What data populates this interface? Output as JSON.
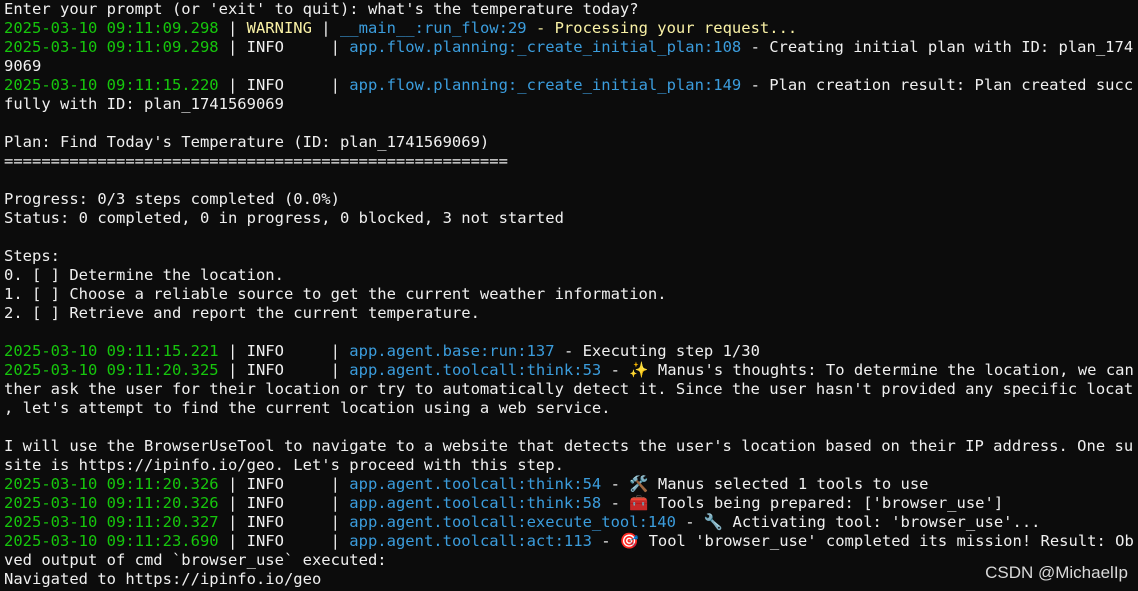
{
  "prompt": "Enter your prompt (or 'exit' to quit): what's the temperature today?",
  "log": [
    {
      "ts": "2025-03-10 09:11:09.298",
      "level": "WARNING",
      "sep": " | ",
      "module": "__main__:run_flow:29",
      "msg": " - Processing your request..."
    },
    {
      "ts": "2025-03-10 09:11:09.298",
      "level": "INFO    ",
      "sep": " | ",
      "module": "app.flow.planning:_create_initial_plan:108",
      "msg": " - Creating initial plan with ID: plan_174156",
      "cont": "9069"
    },
    {
      "ts": "2025-03-10 09:11:15.220",
      "level": "INFO    ",
      "sep": " | ",
      "module": "app.flow.planning:_create_initial_plan:149",
      "msg": " - Plan creation result: Plan created success",
      "cont": "fully with ID: plan_1741569069"
    }
  ],
  "plan": {
    "title": "Plan: Find Today's Temperature (ID: plan_1741569069)",
    "rule": "======================================================",
    "progress": "Progress: 0/3 steps completed (0.0%)",
    "status": "Status: 0 completed, 0 in progress, 0 blocked, 3 not started",
    "steps_header": "Steps:",
    "steps": [
      "0. [ ] Determine the location.",
      "1. [ ] Choose a reliable source to get the current weather information.",
      "2. [ ] Retrieve and report the current temperature."
    ]
  },
  "log2": [
    {
      "ts": "2025-03-10 09:11:15.221",
      "level": "INFO    ",
      "sep": " | ",
      "module": "app.agent.base:run:137",
      "msg": " - Executing step 1/30"
    },
    {
      "ts": "2025-03-10 09:11:20.325",
      "level": "INFO    ",
      "sep": " | ",
      "module": "app.agent.toolcall:think:53",
      "msg": " - ✨ Manus's thoughts: To determine the location, we can ei",
      "cont": "ther ask the user for their location or try to automatically detect it. Since the user hasn't provided any specific location",
      "cont2": ", let's attempt to find the current location using a web service."
    }
  ],
  "thought_para": [
    "I will use the BrowserUseTool to navigate to a website that detects the user's location based on their IP address. One such",
    "site is https://ipinfo.io/geo. Let's proceed with this step."
  ],
  "log3": [
    {
      "ts": "2025-03-10 09:11:20.326",
      "level": "INFO    ",
      "sep": " | ",
      "module": "app.agent.toolcall:think:54",
      "msg": " - 🛠️ Manus selected 1 tools to use"
    },
    {
      "ts": "2025-03-10 09:11:20.326",
      "level": "INFO    ",
      "sep": " | ",
      "module": "app.agent.toolcall:think:58",
      "msg": " - 🧰 Tools being prepared: ['browser_use']"
    },
    {
      "ts": "2025-03-10 09:11:20.327",
      "level": "INFO    ",
      "sep": " | ",
      "module": "app.agent.toolcall:execute_tool:140",
      "msg": " - 🔧 Activating tool: 'browser_use'..."
    },
    {
      "ts": "2025-03-10 09:11:23.690",
      "level": "INFO    ",
      "sep": " | ",
      "module": "app.agent.toolcall:act:113",
      "msg": " - 🎯 Tool 'browser_use' completed its mission! Result: Obser",
      "cont": "ved output of cmd `browser_use` executed:"
    }
  ],
  "final_line": "Navigated to https://ipinfo.io/geo",
  "watermark": "CSDN @MichaelIp",
  "colors": {
    "background": "#0c0c0c",
    "timestamp": "#16c60c",
    "module": "#3b9ddd",
    "warning": "#f9f1a5",
    "text": "#f0f0f0"
  }
}
